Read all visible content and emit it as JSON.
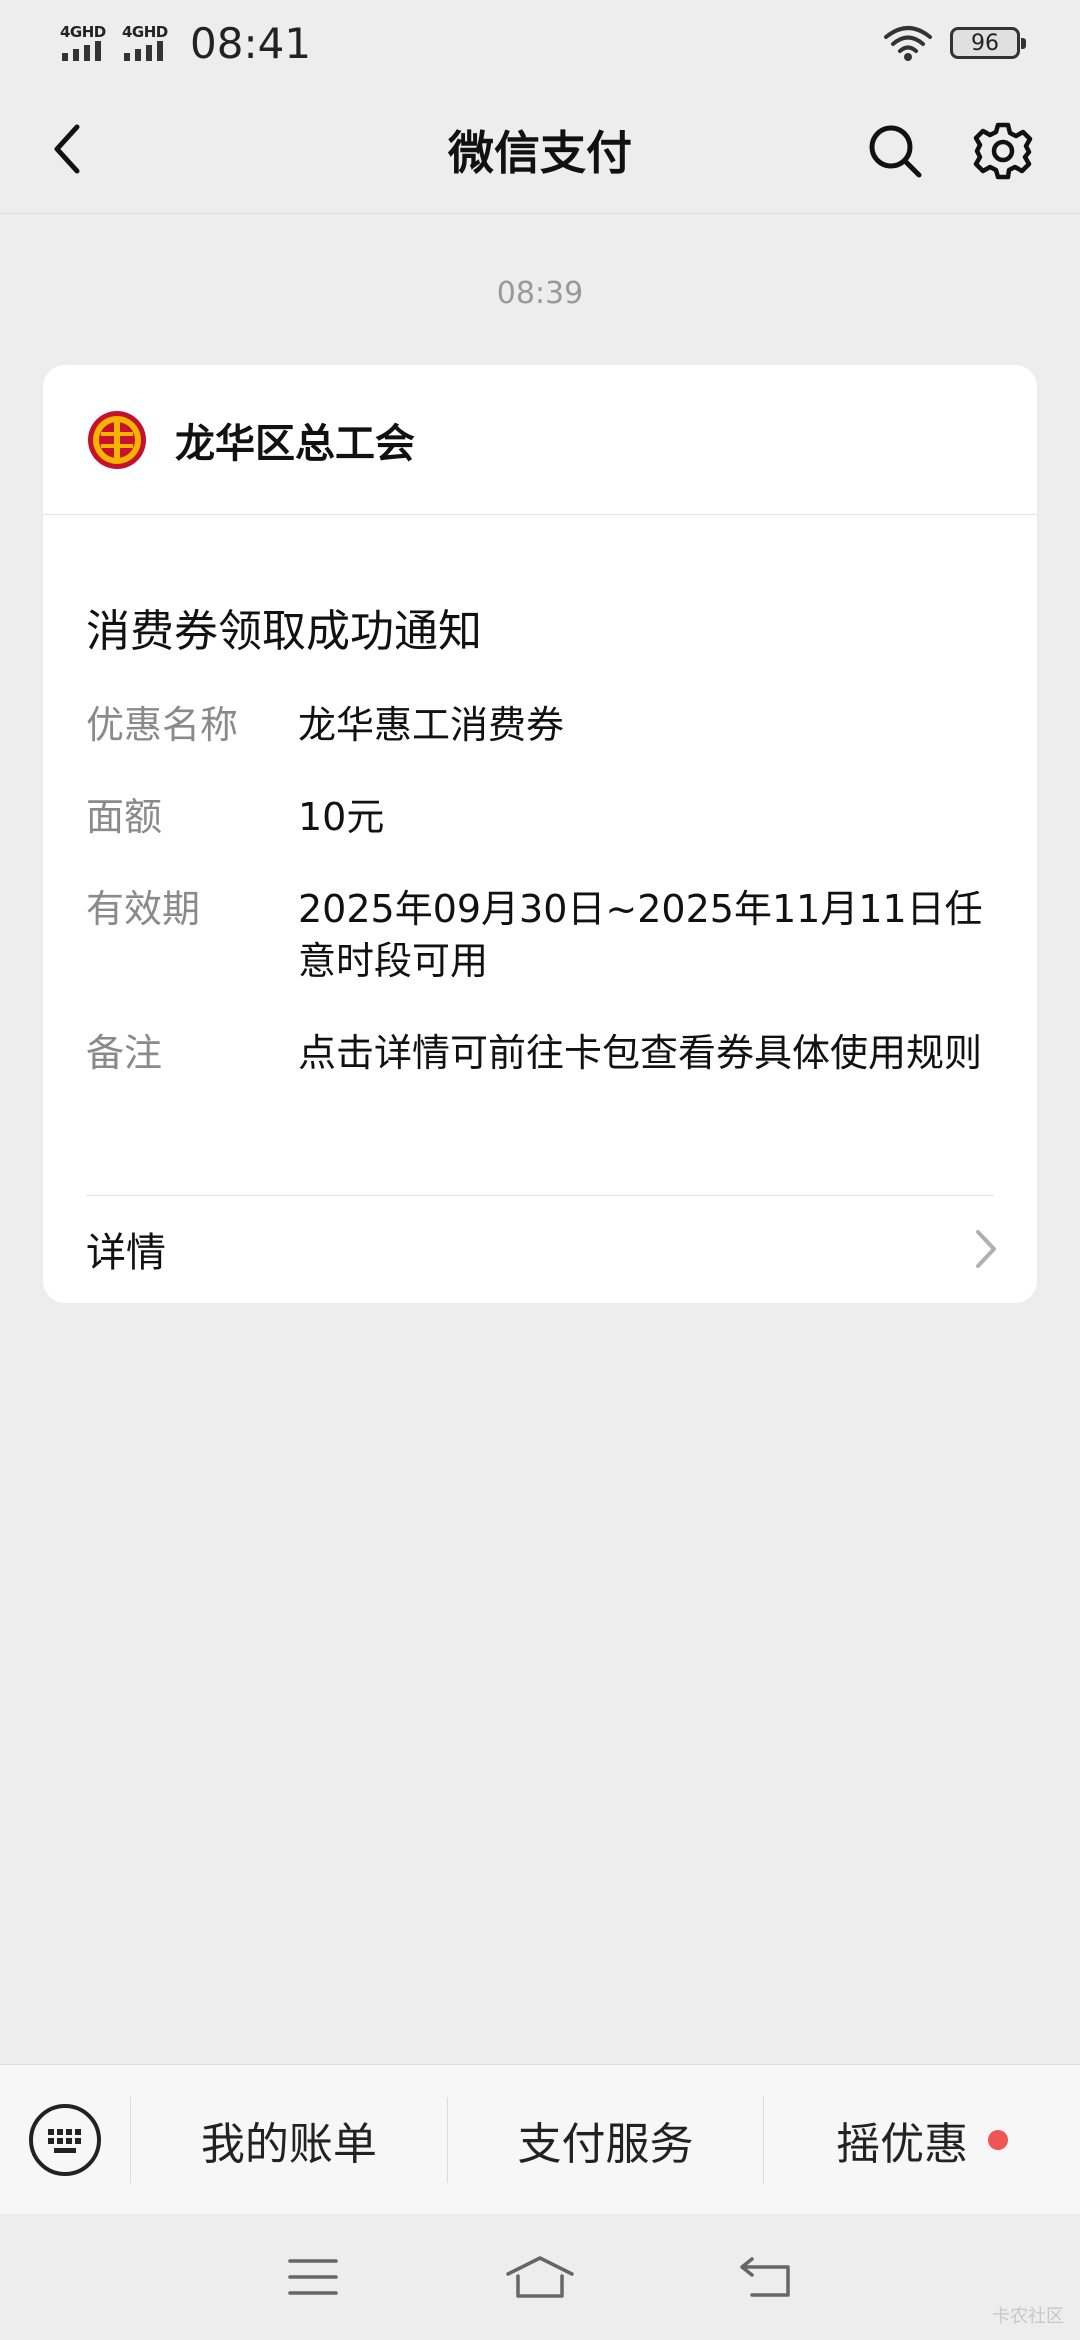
{
  "status_bar": {
    "network_1": "4GHD",
    "network_2": "4GHD",
    "time": "08:41",
    "battery": "96"
  },
  "nav": {
    "title": "微信支付",
    "back_icon": "back-arrow-icon",
    "search_icon": "search-icon",
    "settings_icon": "gear-icon"
  },
  "message": {
    "timestamp": "08:39",
    "sender": "龙华区总工会",
    "sender_logo": "union-logo",
    "title": "消费券领取成功通知",
    "rows": [
      {
        "label": "优惠名称",
        "value": "龙华惠工消费券"
      },
      {
        "label": "面额",
        "value": "10元"
      },
      {
        "label": "有效期",
        "value": "2025年09月30日~2025年11月11日任意时段可用"
      },
      {
        "label": "备注",
        "value": "点击详情可前往卡包查看券具体使用规则"
      }
    ],
    "detail_label": "详情"
  },
  "bottom_menu": {
    "keyboard_icon": "keyboard-icon",
    "items": [
      {
        "label": "我的账单"
      },
      {
        "label": "支付服务"
      },
      {
        "label": "摇优惠"
      }
    ]
  },
  "system_nav": {
    "menu_icon": "menu-icon",
    "home_icon": "home-icon",
    "back_icon": "back-icon"
  },
  "watermark": "卡农社区",
  "colors": {
    "background": "#ededed",
    "card": "#ffffff",
    "badge_dot": "#f05454",
    "label_gray": "#8a8a8a"
  }
}
